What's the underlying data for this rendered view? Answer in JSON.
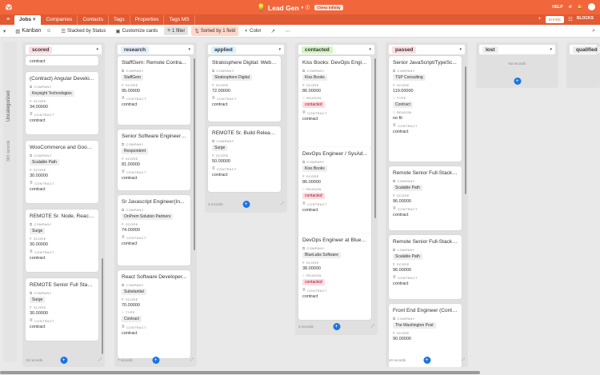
{
  "app": {
    "base_name": "Lead Gen",
    "badge": "Chess Infinity",
    "help": "HELP",
    "share": "SHARE",
    "blocks": "BLOCKS"
  },
  "tabs": [
    {
      "label": "Jobs",
      "active": true
    },
    {
      "label": "Companies"
    },
    {
      "label": "Contacts"
    },
    {
      "label": "Tags"
    },
    {
      "label": "Properties"
    },
    {
      "label": "Tags MS"
    }
  ],
  "toolbar": {
    "view": "Kanban",
    "stacked": "Stacked by Status",
    "customize": "Customize cards",
    "filter": "1 filter",
    "sorted": "Sorted by 1 field",
    "color": "Color"
  },
  "sidebar": {
    "label": "Uncategorized",
    "count": "383 records"
  },
  "columns": [
    {
      "name": "scored",
      "color": "#ffdce0",
      "records": "15 records",
      "cards": [
        {
          "title": "",
          "fields": [
            {
              "label": "CONTRACT",
              "value": "contract",
              "chip": false
            }
          ]
        },
        {
          "title": "(Contract) Angular Develo...",
          "fields": [
            {
              "label": "COMPANY",
              "value": "Keysight Technologies",
              "chip": true
            },
            {
              "label": "SCORE",
              "value": "34.00000"
            },
            {
              "label": "CONTRACT",
              "value": "contract"
            }
          ]
        },
        {
          "title": "WooCommerce and Googl...",
          "fields": [
            {
              "label": "COMPANY",
              "value": "Scalable Path",
              "chip": true
            },
            {
              "label": "SCORE",
              "value": "30.00000"
            },
            {
              "label": "CONTRACT",
              "value": "contract"
            }
          ]
        },
        {
          "title": "REMOTE Sr. Node, React, ...",
          "fields": [
            {
              "label": "COMPANY",
              "value": "Surge",
              "chip": true
            },
            {
              "label": "SCORE",
              "value": "30.00000"
            },
            {
              "label": "CONTRACT",
              "value": "contract"
            }
          ]
        },
        {
          "title": "REMOTE Senior Full Stack...",
          "fields": [
            {
              "label": "COMPANY",
              "value": "Surge",
              "chip": true
            },
            {
              "label": "SCORE",
              "value": "30.00000"
            },
            {
              "label": "CONTRACT",
              "value": "contract"
            }
          ]
        }
      ]
    },
    {
      "name": "research",
      "color": "#e4eefc",
      "records": "7 records",
      "cards": [
        {
          "title": "StaffGem: Remote Contra...",
          "fields": [
            {
              "label": "COMPANY",
              "value": "StaffGem",
              "chip": true
            },
            {
              "label": "SCORE",
              "value": "95.00000"
            },
            {
              "label": "CONTRACT",
              "value": "contract"
            }
          ]
        },
        {
          "title": "Senior Software Engineer ...",
          "fields": [
            {
              "label": "COMPANY",
              "value": "Respondent",
              "chip": true
            },
            {
              "label": "SCORE",
              "value": "81.00000"
            },
            {
              "label": "CONTRACT",
              "value": "contract"
            }
          ]
        },
        {
          "title": "Sr Javascript Engineer(In...",
          "fields": [
            {
              "label": "COMPANY",
              "value": "OnPrem Solution Partners",
              "chip": true
            },
            {
              "label": "SCORE",
              "value": "74.00000"
            },
            {
              "label": "CONTRACT",
              "value": "contract"
            }
          ]
        },
        {
          "title": "React Software Developer...",
          "fields": [
            {
              "label": "COMPANY",
              "value": "Substantial",
              "chip": true
            },
            {
              "label": "SCORE",
              "value": "70.00000"
            },
            {
              "label": "TYPE",
              "value": "Contract",
              "chip": true
            },
            {
              "label": "CONTRACT",
              "value": "contract"
            }
          ]
        }
      ]
    },
    {
      "name": "applied",
      "color": "#d8f3ff",
      "records": "3 records",
      "cards": [
        {
          "title": "Stratosphere Digital: Web ...",
          "fields": [
            {
              "label": "COMPANY",
              "value": "Stratosphere Digital",
              "chip": true
            },
            {
              "label": "SCORE",
              "value": "72.00000"
            },
            {
              "label": "CONTRACT",
              "value": "contract"
            }
          ]
        },
        {
          "title": "REMOTE Sr. Build Release...",
          "fields": [
            {
              "label": "COMPANY",
              "value": "Surge",
              "chip": true
            },
            {
              "label": "SCORE",
              "value": "50.00000"
            },
            {
              "label": "CONTRACT",
              "value": "contract"
            }
          ]
        }
      ]
    },
    {
      "name": "contacted",
      "color": "#d1f7c4",
      "records": "3 records",
      "cards": [
        {
          "title": "Kiss Books: DevOps Engin...",
          "fields": [
            {
              "label": "COMPANY",
              "value": "Kiss Books",
              "chip": true
            },
            {
              "label": "SCORE",
              "value": "86.00000"
            },
            {
              "label": "REASON",
              "value": "contacted",
              "chip": "red"
            },
            {
              "label": "CONTRACT",
              "value": "contract"
            }
          ]
        },
        {
          "title": "DevOps Engineer / SysAd...",
          "fields": [
            {
              "label": "COMPANY",
              "value": "Kiss Books",
              "chip": true
            },
            {
              "label": "SCORE",
              "value": "86.00000"
            },
            {
              "label": "REASON",
              "value": "contacted",
              "chip": "red"
            },
            {
              "label": "CONTRACT",
              "value": "contract"
            }
          ]
        },
        {
          "title": "DevOps Engineer at BlueL...",
          "fields": [
            {
              "label": "COMPANY",
              "value": "BlueLabs Software",
              "chip": true
            },
            {
              "label": "SCORE",
              "value": "38.00000"
            },
            {
              "label": "REASON",
              "value": "contacted",
              "chip": "red"
            },
            {
              "label": "CONTRACT",
              "value": "contract"
            }
          ]
        }
      ]
    },
    {
      "name": "passed",
      "color": "#ffdce0",
      "records": "10 records",
      "cards": [
        {
          "title": "Senior JavaScript/TypeSc...",
          "fields": [
            {
              "label": "COMPANY",
              "value": "TSP Consulting",
              "chip": true
            },
            {
              "label": "SCORE",
              "value": "119.00000"
            },
            {
              "label": "TYPE",
              "value": "Contract",
              "chip": true
            },
            {
              "label": "REASON",
              "value": "no fit"
            },
            {
              "label": "CONTRACT",
              "value": "contract"
            }
          ]
        },
        {
          "title": "Remote Senior Full-Stack ...",
          "fields": [
            {
              "label": "COMPANY",
              "value": "Scalable Path",
              "chip": true
            },
            {
              "label": "SCORE",
              "value": "96.00000"
            },
            {
              "label": "CONTRACT",
              "value": "contract"
            }
          ]
        },
        {
          "title": "Remote Senior Full-Stack ...",
          "fields": [
            {
              "label": "COMPANY",
              "value": "Scalable Path",
              "chip": true
            },
            {
              "label": "SCORE",
              "value": "96.00000"
            },
            {
              "label": "CONTRACT",
              "value": "contract"
            }
          ]
        },
        {
          "title": "Front End Engineer (Contr...",
          "fields": [
            {
              "label": "COMPANY",
              "value": "The Washington Post",
              "chip": true
            },
            {
              "label": "SCORE",
              "value": "90.00000"
            }
          ]
        }
      ]
    },
    {
      "name": "lost",
      "color": "#eeeeee",
      "records": "",
      "norecords": "No records",
      "cards": []
    },
    {
      "name": "qualified",
      "color": "#eeeeee",
      "records": "",
      "cards": []
    }
  ]
}
